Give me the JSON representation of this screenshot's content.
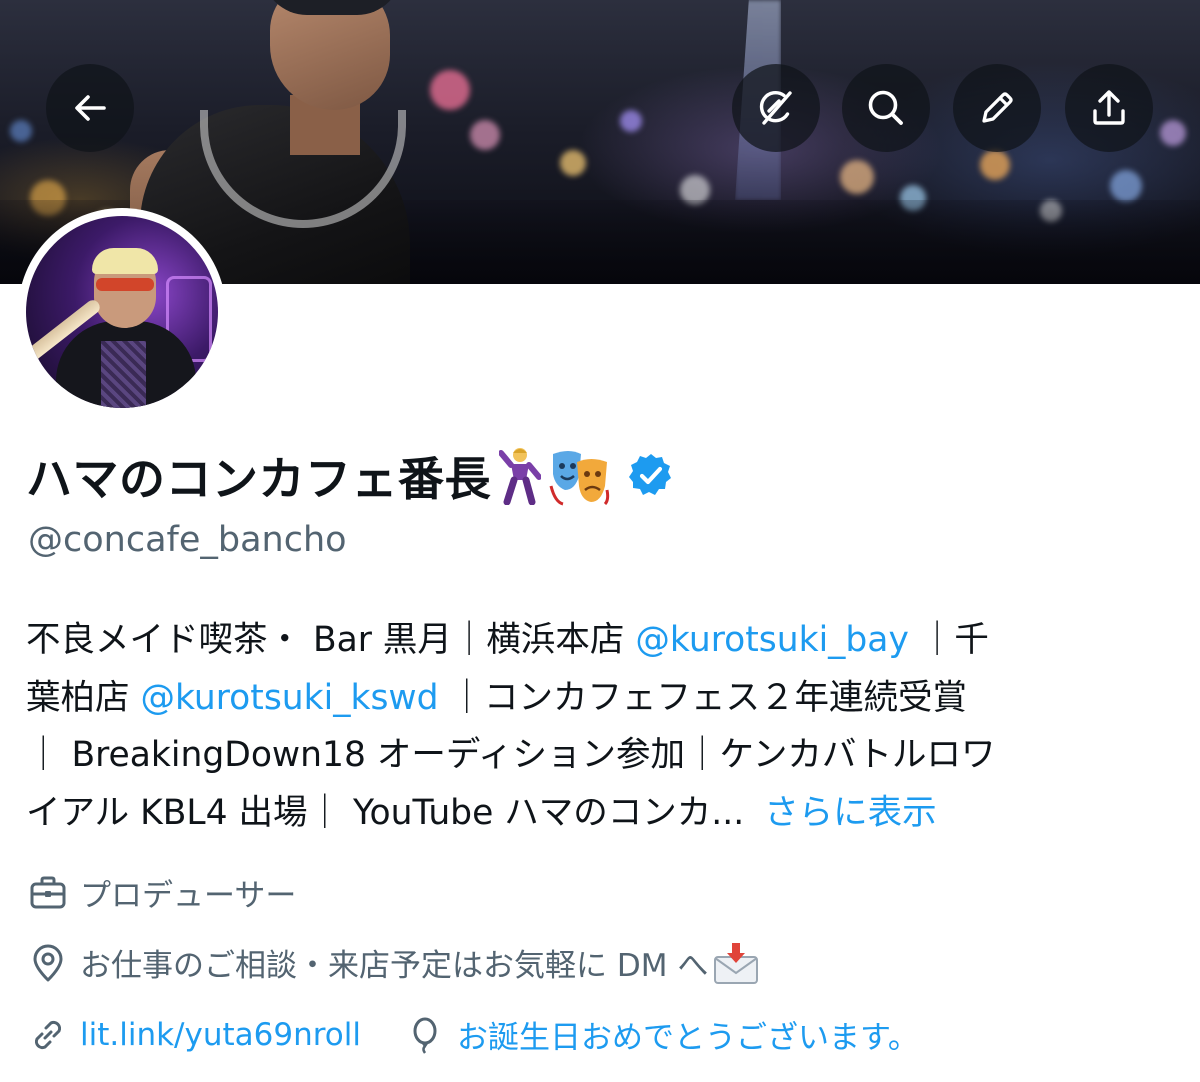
{
  "header": {
    "back_icon": "arrow-left-icon",
    "actions": [
      {
        "name": "grok-icon"
      },
      {
        "name": "search-icon"
      },
      {
        "name": "pencil-icon"
      },
      {
        "name": "share-icon"
      }
    ]
  },
  "profile": {
    "display_name": "ハマのコンカフェ番長",
    "name_emojis": [
      "man-dancing-emoji",
      "performing-arts-emoji"
    ],
    "verified_icon": "verified-badge-icon",
    "handle": "@concafe_bancho"
  },
  "bio": {
    "line1_pre": "不良メイド喫茶・ Bar 黒月｜横浜本店 ",
    "line1_mention": "@kurotsuki_bay",
    "line1_post": " ｜千",
    "line2_pre": "葉柏店 ",
    "line2_mention": "@kurotsuki_kswd",
    "line2_post": " ｜コンカフェフェス２年連続受賞",
    "line3": "｜ BreakingDown18 オーディション参加｜ケンカバトルロワ",
    "line4": "イアル KBL4 出場｜ YouTube ハマのコンカ...",
    "show_more": "さらに表示"
  },
  "meta": {
    "profession": "プロデューサー",
    "location": "お仕事のご相談・来店予定はお気軽に DM へ",
    "location_emoji": "incoming-envelope-emoji",
    "link": "lit.link/yuta69nroll",
    "birthday": "お誕生日おめでとうございます。"
  },
  "colors": {
    "accent": "#1d9bf0",
    "text_primary": "#0f1419",
    "text_secondary": "#536471",
    "verified": "#1d9bf0"
  }
}
